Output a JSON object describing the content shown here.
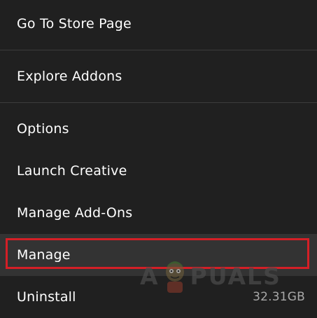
{
  "menu": {
    "items": [
      {
        "label": "Go To Store Page"
      },
      {
        "label": "Explore Addons"
      },
      {
        "label": "Options"
      },
      {
        "label": "Launch Creative"
      },
      {
        "label": "Manage Add-Ons"
      },
      {
        "label": "Manage"
      },
      {
        "label": "Uninstall",
        "size": "32.31GB"
      }
    ]
  },
  "watermark": {
    "text_left": "A",
    "text_right": "PUALS"
  },
  "colors": {
    "background": "#202020",
    "hover": "#333333",
    "highlight_border": "#d41f26",
    "text": "#ffffff",
    "muted_text": "#a8a8a8"
  }
}
